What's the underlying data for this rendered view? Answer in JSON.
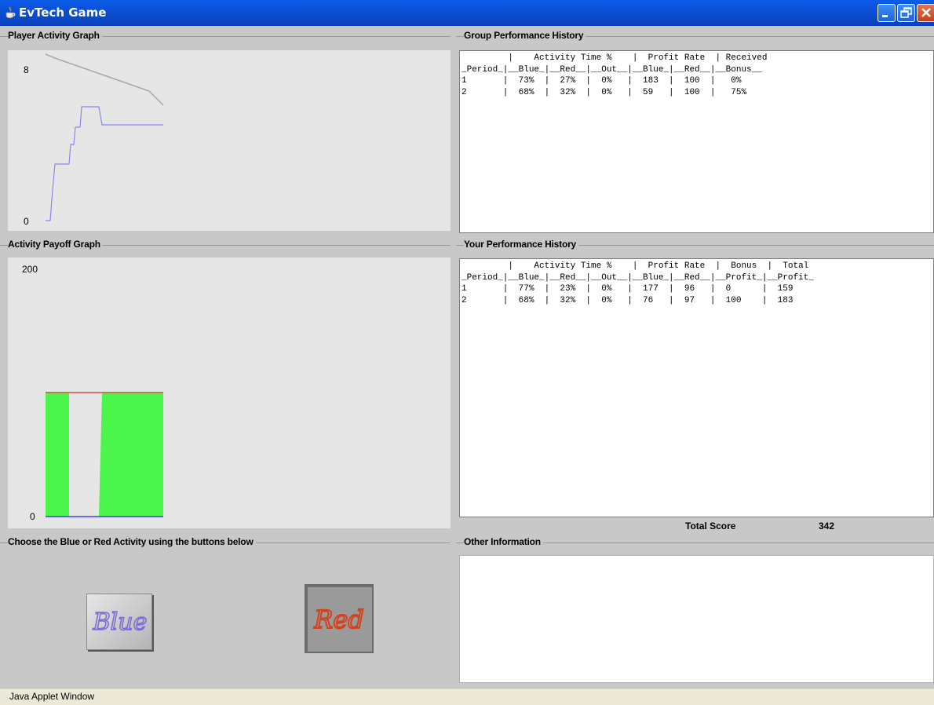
{
  "window": {
    "title": "EvTech Game",
    "app_icon": "java-cup-icon",
    "buttons": [
      "minimize-icon",
      "restore-icon",
      "close-icon"
    ]
  },
  "player_activity": {
    "legend": "Player Activity Graph",
    "y_top": "8",
    "y_bottom": "0"
  },
  "payoff": {
    "legend": "Activity Payoff Graph",
    "y_top": "200",
    "y_bottom": "0"
  },
  "choose": {
    "legend": "Choose the Blue or Red Activity using the buttons below",
    "blue_label": "Blue",
    "red_label": "Red",
    "blue_color": "#7b6fd6",
    "red_color": "#d8401a"
  },
  "group_history": {
    "legend": "Group Performance History",
    "lines": [
      "         |    Activity Time %    |  Profit Rate  | Received",
      "_Period_|__Blue_|__Red__|__Out__|__Blue_|__Red__|__Bonus__",
      "1       |  73%  |  27%  |  0%   |  183  |  100  |   0%",
      "2       |  68%  |  32%  |  0%   |  59   |  100  |   75%"
    ]
  },
  "your_history": {
    "legend": "Your Performance History",
    "lines": [
      "         |    Activity Time %    |  Profit Rate  |  Bonus  |  Total",
      "_Period_|__Blue_|__Red__|__Out__|__Blue_|__Red__|__Profit_|__Profit_",
      "1       |  77%  |  23%  |  0%   |  177  |  96   |  0      |  159",
      "2       |  68%  |  32%  |  0%   |  76   |  97   |  100    |  183"
    ],
    "total_score_label": "Total Score",
    "total_score_value": "342"
  },
  "other_info": {
    "legend": "Other Information",
    "text": ""
  },
  "status": {
    "text": "Java Applet Window"
  }
}
